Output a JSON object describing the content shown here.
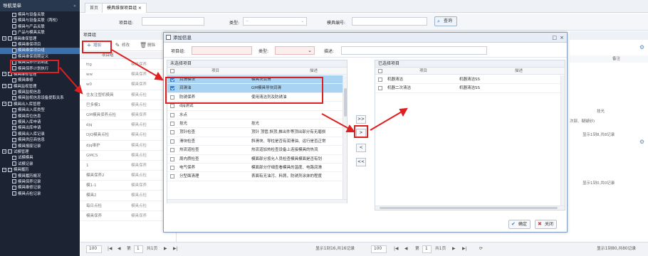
{
  "sidebar": {
    "title": "导航菜单",
    "collapse_icon": "double-chevron-left",
    "items": [
      {
        "label": "模具与设备关联",
        "level": 1
      },
      {
        "label": "模具与设备关联（两校）",
        "level": 1
      },
      {
        "label": "模具与产品关联",
        "level": 1
      },
      {
        "label": "产品与模具关联",
        "level": 1
      },
      {
        "label": "模具维保管理",
        "level": 0,
        "expanded": true
      },
      {
        "label": "模具维保项目",
        "level": 1
      },
      {
        "label": "模具维保项目组",
        "level": 1,
        "selected": true
      },
      {
        "label": "模具维保周期定义",
        "level": 1
      },
      {
        "label": "模具保养计划制定",
        "level": 1
      },
      {
        "label": "模具保养计划执行",
        "level": 1
      },
      {
        "label": "模具维修管理",
        "level": 0,
        "expanded": true
      },
      {
        "label": "模具维修",
        "level": 1
      },
      {
        "label": "模具监视管理",
        "level": 0,
        "expanded": true
      },
      {
        "label": "模具监视信息",
        "level": 1
      },
      {
        "label": "模具监视信息设备提取关系",
        "level": 1
      },
      {
        "label": "模具出入库管理",
        "level": 0,
        "expanded": true
      },
      {
        "label": "模具出入库类型",
        "level": 1
      },
      {
        "label": "模具库位信息",
        "level": 1
      },
      {
        "label": "模具入库申请",
        "level": 1
      },
      {
        "label": "模具出库申请",
        "level": 1
      },
      {
        "label": "模具出入库记录",
        "level": 1
      },
      {
        "label": "模具供应商信息",
        "level": 1
      },
      {
        "label": "模具报废记录",
        "level": 1
      },
      {
        "label": "试模管理",
        "level": 0,
        "expanded": true
      },
      {
        "label": "试模模具",
        "level": 1
      },
      {
        "label": "试模记录",
        "level": 1
      },
      {
        "label": "模具履历",
        "level": 0,
        "expanded": true
      },
      {
        "label": "模具履历概况",
        "level": 1
      },
      {
        "label": "模具保养记录",
        "level": 1
      },
      {
        "label": "模具维修记录",
        "level": 1
      },
      {
        "label": "模具点检记录",
        "level": 1
      }
    ]
  },
  "tabs": [
    {
      "label": "首页",
      "active": false
    },
    {
      "label": "模具维保项目组 ×",
      "active": true
    }
  ],
  "search": {
    "group_label": "项目组:",
    "type_label": "类型:",
    "type_value": "--",
    "model_label": "模具编号:",
    "query_label": "查询"
  },
  "main_list": {
    "title": "项目组",
    "toolbar": {
      "add": "增加",
      "edit": "修改",
      "delete": "删除"
    },
    "columns": [
      "项目组",
      ""
    ],
    "rows": [
      {
        "name": "ttg",
        "type": "模具保养"
      },
      {
        "name": "ww",
        "type": "模具保养"
      },
      {
        "name": "w0",
        "type": "模具保养"
      },
      {
        "name": "住友注塑机模具",
        "type": "模具点检"
      },
      {
        "name": "巴多模1",
        "type": "模具点检"
      },
      {
        "name": "GM模具保养点检",
        "type": "模具保养"
      },
      {
        "name": "djq",
        "type": "模具点检"
      },
      {
        "name": "DJQ模具点检",
        "type": "模具点检"
      },
      {
        "name": "djq维护",
        "type": "模具点检"
      },
      {
        "name": "GMCS",
        "type": "模具点检"
      },
      {
        "name": "1",
        "type": "模具保养"
      },
      {
        "name": "模具保养2",
        "type": "模具点检"
      },
      {
        "name": "模1-1",
        "type": "模具保养"
      },
      {
        "name": "模具2",
        "type": "模具点检"
      },
      {
        "name": "每日点检",
        "type": "模具点检"
      },
      {
        "name": "模具保养",
        "type": "模具保养"
      }
    ]
  },
  "right_panel": {
    "col_label": "备注",
    "note1": "挂光",
    "note2": "次部、疑疑砂)",
    "summary1": "显示1到8,共8记录",
    "summary2": "显示1到0,共0记录"
  },
  "pager": {
    "page_size": "100",
    "page_label": "第",
    "page_value": "1",
    "page_total": "共1页",
    "summary": "显示1到16,共16记录",
    "dialog_page_size": "100",
    "dialog_page_value": "1",
    "dialog_page_total": "共1页",
    "dialog_summary": "显示1到80,共80记录"
  },
  "dialog": {
    "title": "添加信息",
    "filter": {
      "group_label": "项目组:",
      "type_label": "类型:",
      "desc_label": "描述:"
    },
    "unselected_title": "未选择项目",
    "selected_title": "已选择项目",
    "col_item": "项目",
    "col_desc": "描述",
    "left_rows": [
      {
        "name": "润滑模块",
        "desc": "模具块润滑",
        "checked": true
      },
      {
        "name": "润滑油",
        "desc": "GM模具导块润滑",
        "checked": true
      },
      {
        "name": "防锈保养",
        "desc": "使用清洁剂及防锈油",
        "checked": false
      },
      {
        "name": "djq测试",
        "desc": "",
        "checked": false
      },
      {
        "name": "水点",
        "desc": "",
        "checked": false
      },
      {
        "name": "挂光",
        "desc": "挂光",
        "checked": false
      },
      {
        "name": "顶针检查",
        "desc": "顶针 顶管,斜顶,推出件等顶出部分有无磨损",
        "checked": false
      },
      {
        "name": "滑块检查",
        "desc": "斜滑块、导柱是否有润滑油、运行是否正常",
        "checked": false
      },
      {
        "name": "热流道检查",
        "desc": "热流道加热检查设备上连接模具的热流",
        "checked": false
      },
      {
        "name": "周内质检查",
        "desc": "模面部分按允人员检查模具模面是否有划",
        "checked": false
      },
      {
        "name": "电气保养",
        "desc": "模面部分仔细查看模具的温度、电路润滑",
        "checked": false
      },
      {
        "name": "分型面清理",
        "desc": "表面有无油污、料屑，防锈剂涂抹的程度",
        "checked": false
      }
    ],
    "right_rows": [
      {
        "name": "机器清洁",
        "desc": "机器清洁SS"
      },
      {
        "name": "机器二次清洁",
        "desc": "机器清洁SS"
      }
    ],
    "buttons": {
      "add_all": ">>",
      "add": ">",
      "remove": "<",
      "remove_all": "<<"
    },
    "confirm_label": "确定",
    "close_label": "关闭"
  },
  "colors": {
    "sidebar_bg": "#1c2434",
    "selected_row": "#a9d3f3",
    "annotation_red": "#e02020",
    "accent": "#3c6fae"
  }
}
